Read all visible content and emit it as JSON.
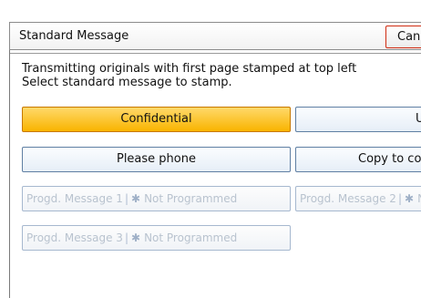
{
  "header": {
    "title": "Standard Message",
    "cancel_label": "Can"
  },
  "message": {
    "line1": "Transmitting originals with first page stamped at top left",
    "line2": "Select standard message to stamp."
  },
  "buttons": {
    "confidential": "Confidential",
    "urgent": "Ur",
    "please_phone": "Please phone",
    "copy_to": "Copy to co",
    "prog1_label": "Progd. Message 1",
    "prog1_status": "Not Programmed",
    "prog2_label": "Progd. Message 2",
    "prog2_status": "N",
    "prog3_label": "Progd. Message 3",
    "prog3_status": "Not Programmed"
  },
  "glyphs": {
    "separator": "|",
    "star": "✱"
  },
  "colors": {
    "selected": "#f9b400",
    "button_border": "#5f7fa3",
    "cancel_border": "#d02c12"
  }
}
